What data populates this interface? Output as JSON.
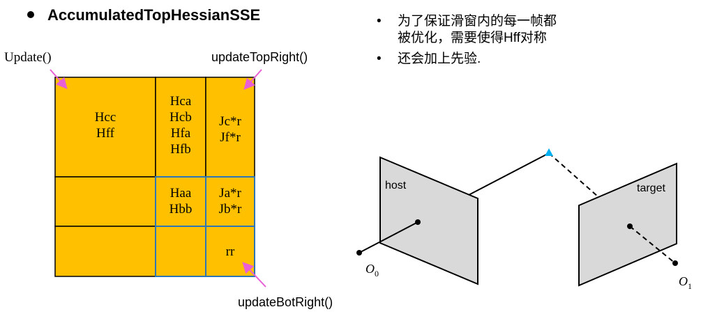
{
  "heading": "AccumulatedTopHessianSSE",
  "notes": {
    "line1": "为了保证滑窗内的每一帧都",
    "line2": "被优化，需要使得Hff对称",
    "line3": "还会加上先验.",
    "bullet_glyph": "•"
  },
  "callouts": {
    "update": "Update()",
    "top_right": "updateTopRight()",
    "bot_right": "updateBotRight()"
  },
  "matrix": {
    "fill_color": "#FFC000",
    "block_border": "#000000",
    "highlight_border": "#2E75B6",
    "cells": {
      "cc_ff": "Hcc\nHff",
      "ca_cb_fa_fb": "Hca\nHcb\nHfa\nHfb",
      "jc_jf": "Jc*r\nJf*r",
      "aa_bb": "Haa\nHbb",
      "ja_jb": "Ja*r\nJb*r",
      "rr": "rr"
    },
    "arrow_color": "#E85FD6"
  },
  "camera_diagram": {
    "host_label": "host",
    "target_label": "target",
    "origin0": "O",
    "origin0_sub": "0",
    "origin1": "O",
    "origin1_sub": "1",
    "plane_color": "#D9D9D9",
    "point_color": "#00B0F0"
  }
}
